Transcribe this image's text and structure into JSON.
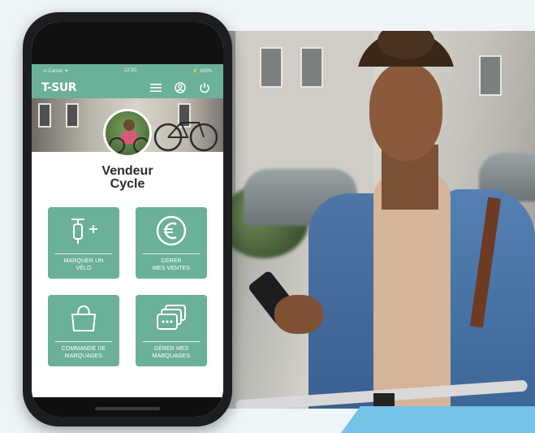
{
  "status_bar": {
    "carrier": "ııl Carrier ✦",
    "time": "22:30",
    "battery": "⚡ 100%"
  },
  "app_bar": {
    "logo": "T-SUR",
    "menu_icon": "hamburger-menu-icon",
    "profile_icon": "user-circle-icon",
    "power_icon": "power-icon"
  },
  "profile": {
    "name_line1": "Vendeur",
    "name_line2": "Cycle"
  },
  "tiles": [
    {
      "label_line1": "MARQUER UN",
      "label_line2": "VÉLO",
      "icon": "bike-plus-icon"
    },
    {
      "label_line1": "GÉRER",
      "label_line2": "MES VENTES",
      "icon": "euro-icon"
    },
    {
      "label_line1": "COMMANDE DE",
      "label_line2": "MARQUAGES",
      "icon": "shopping-bag-icon"
    },
    {
      "label_line1": "GÉRER MES",
      "label_line2": "MARQUAGES",
      "icon": "stacked-windows-icon"
    }
  ],
  "colors": {
    "primary": "#6bb09b",
    "accent": "#73c3e6",
    "text": "#2b2b2b"
  }
}
